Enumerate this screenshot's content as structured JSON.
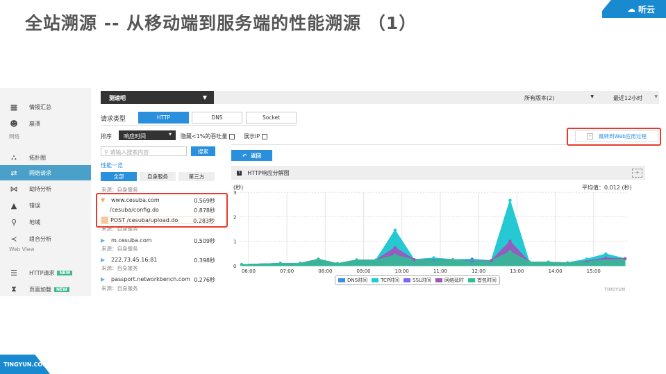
{
  "slide": {
    "title": "全站溯源 -- 从移动端到服务端的性能溯源 （1）",
    "logo": "听云",
    "footer": "TINGYUN.COM"
  },
  "sidebar": {
    "items": [
      {
        "label": "情报汇总",
        "icon": "grid-icon",
        "y": 16
      },
      {
        "label": "崩溃",
        "icon": "skull-icon",
        "y": 40
      }
    ],
    "section_network": "网络",
    "net_items": [
      {
        "label": "拓扑图",
        "icon": "topology-icon",
        "y": 89
      },
      {
        "label": "网络请求",
        "icon": "swap-icon",
        "y": 111,
        "active": true
      },
      {
        "label": "劫持分析",
        "icon": "hijack-icon",
        "y": 134
      },
      {
        "label": "错误",
        "icon": "warning-icon",
        "y": 158
      },
      {
        "label": "地域",
        "icon": "location-icon",
        "y": 182
      },
      {
        "label": "组合分析",
        "icon": "share-icon",
        "y": 206
      }
    ],
    "section_webview": "Web View",
    "web_items": [
      {
        "label": "HTTP请求",
        "icon": "list-icon",
        "badge": "NEW",
        "y": 255
      },
      {
        "label": "页面加载",
        "icon": "hourglass-icon",
        "badge": "NEW",
        "y": 279
      }
    ]
  },
  "header": {
    "app_select": "测速吧",
    "version_select": "所有版本(2)",
    "time_select": "最近12小时"
  },
  "filters": {
    "request_type_label": "请求类型",
    "types": [
      "HTTP",
      "DNS",
      "Socket"
    ],
    "sort_label": "排序",
    "sort_value": "响应时间",
    "hide_label": "隐藏<1%的吞吐量",
    "show_ip_label": "展示IP",
    "search_placeholder": "请输入搜索内容",
    "search_button": "搜索",
    "overview": "性能一览",
    "tabs": [
      "全部",
      "自身服务",
      "第三方"
    ],
    "jump_button": "跳转到Web应用过程"
  },
  "list": {
    "source_label": "来源：自身服务",
    "expanded": {
      "host": "www.cesuba.com",
      "time": "0.569秒",
      "children": [
        {
          "path": "/cesuba/config.do",
          "time": "0.878秒"
        },
        {
          "path": "POST /cesuba/upload.do",
          "time": "0.283秒"
        }
      ]
    },
    "items": [
      {
        "host": "m.cesuba.com",
        "time": "0.509秒"
      },
      {
        "host": "222.73.45.16:81",
        "time": "0.398秒"
      },
      {
        "host": "passport.networkbench.com",
        "time": "0.276秒"
      }
    ]
  },
  "panel": {
    "back_button": "返回",
    "chart_title": "HTTP响应分解图",
    "unit": "(秒)",
    "average": "平均值：0.012 (秒)",
    "watermark": "TINGYUN"
  },
  "chart_data": {
    "type": "area",
    "stacked": true,
    "title": "HTTP响应分解图",
    "ylabel": "秒",
    "ylim": [
      0,
      3
    ],
    "yticks": [
      "0",
      "1",
      "2",
      "3"
    ],
    "xticks": [
      "06:00",
      "07:00",
      "08:00",
      "09:00",
      "10:00",
      "11:00",
      "12:00",
      "13:00",
      "14:00",
      "15:00"
    ],
    "x": [
      5.82,
      6.83,
      7.34,
      7.82,
      8.32,
      8.82,
      9.32,
      9.82,
      10.32,
      10.83,
      11.33,
      11.83,
      12.33,
      12.82,
      13.32,
      13.82,
      14.32,
      14.82,
      15.32,
      15.82
    ],
    "series": [
      {
        "name": "首包时间",
        "color": "#2fbf95",
        "values": [
          0.05,
          0.1,
          0.1,
          0.27,
          0.09,
          0.24,
          0.23,
          0.43,
          0.24,
          0.25,
          0.25,
          0.17,
          0.2,
          0.58,
          0.16,
          0.15,
          0.12,
          0.18,
          0.23,
          0.28
        ]
      },
      {
        "name": "网络延时",
        "color": "#9b59b6",
        "values": [
          0,
          0,
          0,
          0,
          0,
          0,
          0,
          0.31,
          0.01,
          0.02,
          0,
          0.02,
          0.01,
          0.42,
          0,
          0,
          0,
          0.02,
          0.08,
          0.01
        ]
      },
      {
        "name": "SSL时间",
        "color": "#7b68ee",
        "values": [
          0,
          0,
          0,
          0,
          0,
          0,
          0,
          0,
          0,
          0,
          0,
          0,
          0,
          0,
          0,
          0,
          0,
          0,
          0,
          0
        ]
      },
      {
        "name": "TCP时间",
        "color": "#1ccfcf",
        "values": [
          0,
          0,
          0,
          0,
          0,
          0,
          0,
          0.71,
          0,
          0.05,
          0,
          0.06,
          0,
          1.67,
          0,
          0,
          0,
          0.07,
          0.17,
          0
        ]
      },
      {
        "name": "DNS时间",
        "color": "#3a8ee6",
        "values": [
          0,
          0,
          0,
          0,
          0,
          0,
          0,
          0,
          0,
          0,
          0,
          0.02,
          0,
          0,
          0,
          0,
          0,
          0,
          0,
          0
        ]
      }
    ],
    "legend": [
      "DNS时间",
      "TCP时间",
      "SSL时间",
      "网络延时",
      "首包时间"
    ],
    "legend_colors": [
      "#3a8ee6",
      "#1ccfcf",
      "#7b68ee",
      "#9b59b6",
      "#2fbf95"
    ],
    "legend_position": "bottom"
  }
}
